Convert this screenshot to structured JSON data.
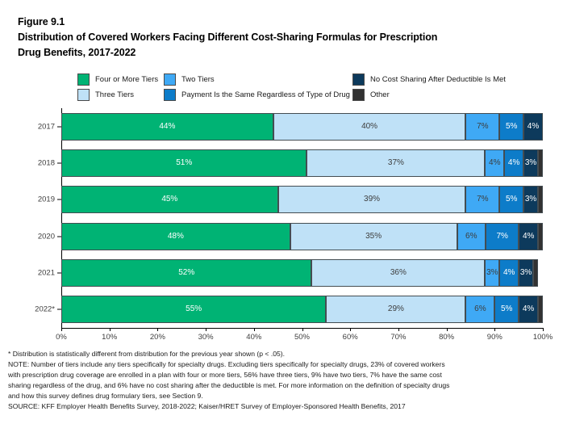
{
  "title": {
    "line1": "Figure 9.1",
    "line2": "Distribution of Covered Workers Facing Different Cost-Sharing Formulas for Prescription",
    "line3": "Drug Benefits, 2017-2022"
  },
  "legend": {
    "col1": [
      {
        "label": "Four or More Tiers",
        "color": "#00b374"
      },
      {
        "label": "Three Tiers",
        "color": "#bfe1f7"
      }
    ],
    "col2": [
      {
        "label": "Two Tiers",
        "color": "#3fa9f5"
      },
      {
        "label": "Payment Is the Same Regardless of Type of Drug",
        "color": "#0d7cc9"
      }
    ],
    "col3": [
      {
        "label": "No Cost Sharing After Deductible Is Met",
        "color": "#0d3a5c"
      },
      {
        "label": "Other",
        "color": "#323232"
      }
    ]
  },
  "chart_data": {
    "type": "bar",
    "orientation": "horizontal",
    "stacked": true,
    "stack_mode": "percent",
    "title": "Distribution of Covered Workers Facing Different Cost-Sharing Formulas for Prescription Drug Benefits, 2017-2022",
    "xlabel": "",
    "ylabel": "",
    "xlim": [
      0,
      100
    ],
    "xticks": [
      0,
      10,
      20,
      30,
      40,
      50,
      60,
      70,
      80,
      90,
      100
    ],
    "xtick_labels": [
      "0%",
      "10%",
      "20%",
      "30%",
      "40%",
      "50%",
      "60%",
      "70%",
      "80%",
      "90%",
      "100%"
    ],
    "grid": false,
    "legend_position": "top",
    "categories": [
      "2017",
      "2018",
      "2019",
      "2020",
      "2021",
      "2022*"
    ],
    "series": [
      {
        "name": "Four or More Tiers",
        "color": "#00b374",
        "text_color": "#ffffff",
        "values": [
          44,
          51,
          45,
          48,
          52,
          55
        ],
        "labels": [
          "44%",
          "51%",
          "45%",
          "48%",
          "52%",
          "55%"
        ]
      },
      {
        "name": "Three Tiers",
        "color": "#bfe1f7",
        "text_color": "#3d3d3d",
        "values": [
          40,
          37,
          39,
          35,
          36,
          29
        ],
        "labels": [
          "40%",
          "37%",
          "39%",
          "35%",
          "36%",
          "29%"
        ]
      },
      {
        "name": "Two Tiers",
        "color": "#3fa9f5",
        "text_color": "#3d3d3d",
        "values": [
          7,
          4,
          7,
          6,
          3,
          6
        ],
        "labels": [
          "7%",
          "4%",
          "7%",
          "6%",
          "3%",
          "6%"
        ]
      },
      {
        "name": "Payment Is the Same Regardless of Type of Drug",
        "color": "#0d7cc9",
        "text_color": "#ffffff",
        "values": [
          5,
          4,
          5,
          7,
          4,
          5
        ],
        "labels": [
          "5%",
          "4%",
          "5%",
          "7%",
          "4%",
          "5%"
        ]
      },
      {
        "name": "No Cost Sharing After Deductible Is Met",
        "color": "#0d3a5c",
        "text_color": "#ffffff",
        "values": [
          4,
          3,
          3,
          4,
          3,
          4
        ],
        "labels": [
          "4%",
          "3%",
          "3%",
          "4%",
          "3%",
          "4%"
        ]
      },
      {
        "name": "Other",
        "color": "#323232",
        "text_color": "#ffffff",
        "values": [
          0,
          1,
          1,
          1,
          1,
          1
        ],
        "labels": [
          "",
          "",
          "",
          "",
          "",
          ""
        ]
      }
    ]
  },
  "notes": [
    "* Distribution is statistically different from distribution for the previous year shown (p < .05).",
    "NOTE: Number of tiers include any tiers specifically for specialty drugs. Excluding tiers specifically for specialty drugs, 23% of covered workers",
    "with prescription drug coverage are enrolled in a plan with four or more tiers, 56% have three tiers, 9% have two tiers, 7% have the same cost",
    "sharing regardless of the drug, and 6% have no cost sharing after the deductible is met. For more information on the definition of specialty drugs",
    "and how this survey defines drug formulary tiers, see Section 9.",
    "SOURCE: KFF Employer Health Benefits Survey, 2018-2022; Kaiser/HRET Survey of Employer-Sponsored Health Benefits, 2017"
  ]
}
